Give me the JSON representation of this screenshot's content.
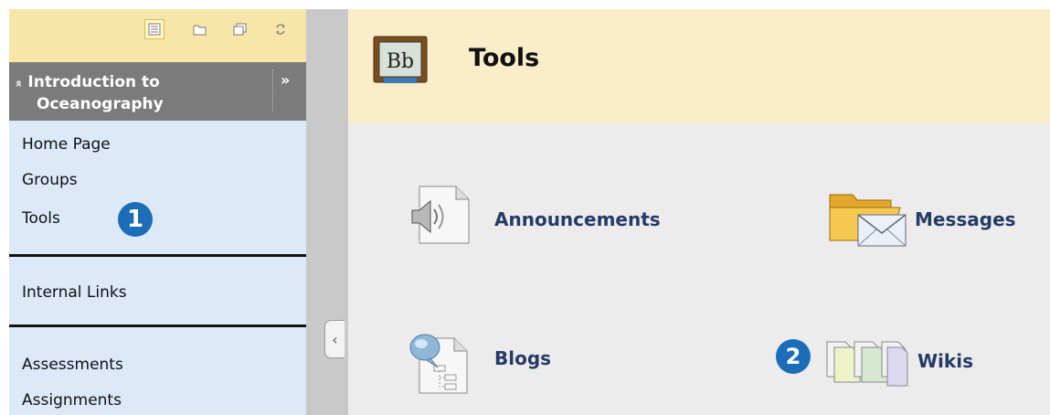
{
  "sidebar": {
    "toolbar": {
      "icons": [
        "list-view-icon",
        "folder-view-icon",
        "window-view-icon",
        "refresh-icon"
      ]
    },
    "course": {
      "collapse_glyph": "«",
      "title_line1": "Introduction to",
      "title_line2": "Oceanography",
      "expand_glyph": "»"
    },
    "items": [
      {
        "label": "Home Page"
      },
      {
        "label": "Groups"
      },
      {
        "label": "Tools"
      },
      {
        "label": "Internal Links"
      },
      {
        "label": "Assessments"
      },
      {
        "label": "Assignments"
      }
    ],
    "callout": "1"
  },
  "collapse_tab": {
    "glyph": "‹"
  },
  "main": {
    "title": "Tools",
    "logo_text": "Bb",
    "tools": [
      {
        "label": "Announcements",
        "icon": "announcements-icon"
      },
      {
        "label": "Messages",
        "icon": "messages-icon"
      },
      {
        "label": "Blogs",
        "icon": "blogs-icon"
      },
      {
        "label": "Wikis",
        "icon": "wikis-icon"
      }
    ],
    "callout": "2"
  },
  "colors": {
    "sidebar_bg": "#dce9f8",
    "toolbar_bg": "#f8e6a8",
    "course_header_bg": "#7b7b7b",
    "header_bg": "#fbedc9",
    "body_bg": "#ececec",
    "link": "#243b67",
    "callout": "#1c6db7"
  }
}
